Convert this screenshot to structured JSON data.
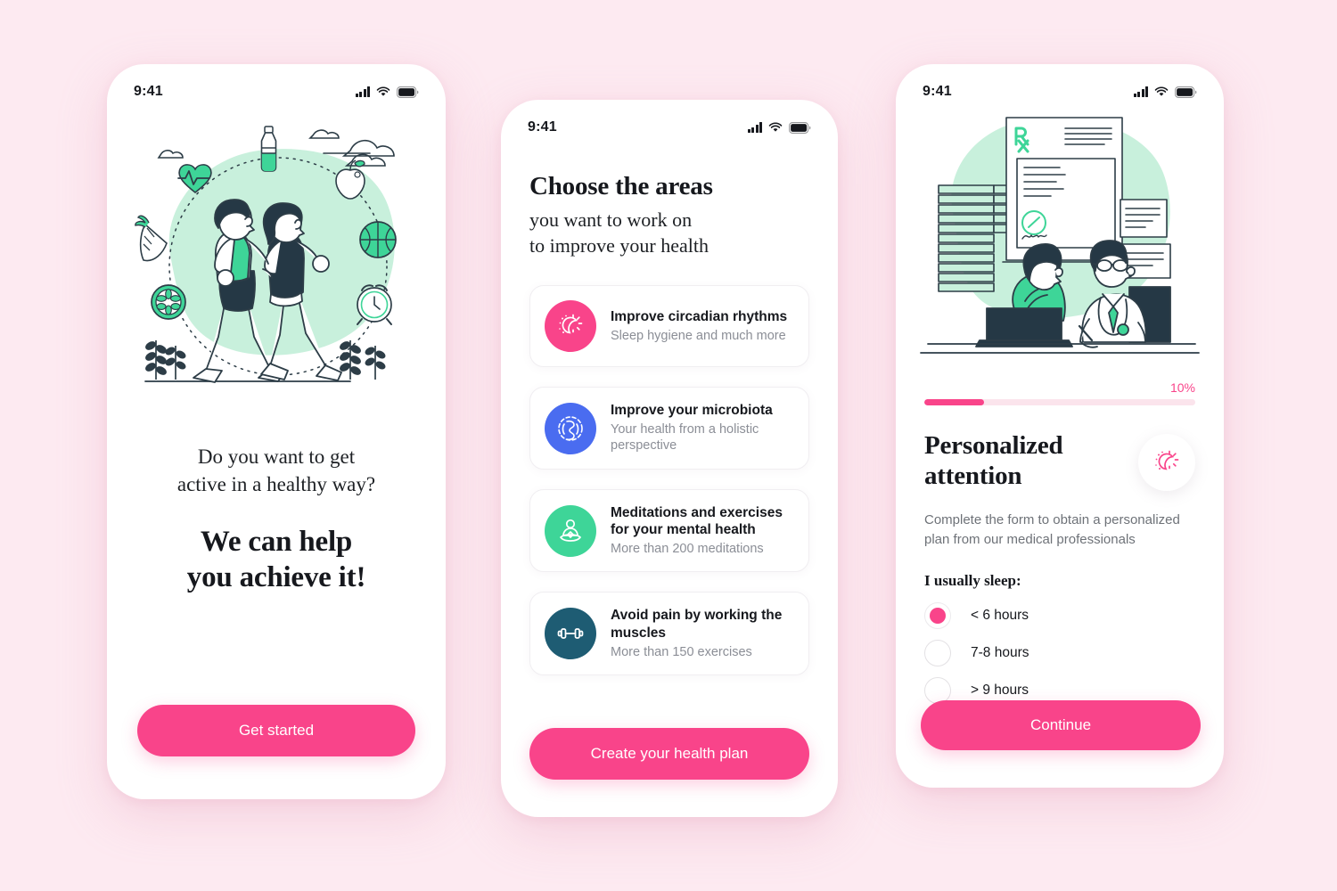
{
  "theme": {
    "page_background": "#fdeaf1",
    "accent_pink": "#f9448a",
    "accent_green": "#3ed598",
    "accent_blue": "#4a6cf0",
    "accent_teal": "#1e5c73",
    "mint_blob": "#c8f0dc",
    "ink": "#16181d"
  },
  "screens": {
    "onboarding": {
      "status_bar": {
        "time": "9:41",
        "signal_icon": "signal-icon",
        "wifi_icon": "wifi-icon",
        "battery_icon": "battery-icon"
      },
      "illustration": "walking-couple-healthy-lifestyle-illustration",
      "subtitle_line_1": "Do you want to get",
      "subtitle_line_2": "active in a healthy way?",
      "headline_line_1": "We can help",
      "headline_line_2": "you achieve it!",
      "cta_label": "Get started"
    },
    "choose_areas": {
      "status_bar": {
        "time": "9:41",
        "signal_icon": "signal-icon",
        "wifi_icon": "wifi-icon",
        "battery_icon": "battery-icon"
      },
      "title": "Choose the areas",
      "subtitle_line_1": "you want to work on",
      "subtitle_line_2": "to improve your health",
      "cards": [
        {
          "title": "Improve circadian rhythms",
          "description": "Sleep hygiene and much more",
          "icon": "circadian-sun-moon-icon",
          "color": "#f9448a"
        },
        {
          "title": "Improve your microbiota",
          "description": "Your health from a holistic perspective",
          "icon": "microbiota-intestine-icon",
          "color": "#4a6cf0"
        },
        {
          "title": "Meditations and exercises for your mental health",
          "description": "More than 200 meditations",
          "icon": "meditation-lotus-icon",
          "color": "#3ed598"
        },
        {
          "title": "Avoid pain by working the muscles",
          "description": "More than 150 exercises",
          "icon": "dumbbell-icon",
          "color": "#1e5c73"
        }
      ],
      "cta_label": "Create your health plan"
    },
    "personalized_form": {
      "status_bar": {
        "time": "9:41",
        "signal_icon": "signal-icon",
        "wifi_icon": "wifi-icon",
        "battery_icon": "battery-icon"
      },
      "illustration": "doctor-consultation-prescription-illustration",
      "progress_label": "10%",
      "progress_percent": 22,
      "title_line_1": "Personalized",
      "title_line_2": "attention",
      "badge_icon": "circadian-sun-moon-icon",
      "description": "Complete the form  to obtain a personalized plan from our medical professionals",
      "question": "I usually sleep:",
      "options": [
        {
          "label": "< 6 hours",
          "selected": true
        },
        {
          "label": "7-8 hours",
          "selected": false
        },
        {
          "label": "> 9 hours",
          "selected": false
        }
      ],
      "cta_label": "Continue"
    }
  }
}
